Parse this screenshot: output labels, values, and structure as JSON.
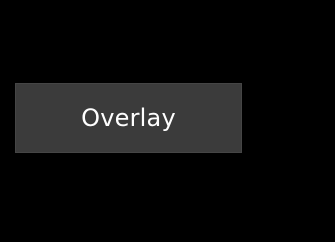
{
  "overlay_button": {
    "label": "Overlay"
  },
  "colors": {
    "background": "#000000",
    "button_background": "#3b3b3b",
    "button_text": "#ffffff"
  }
}
